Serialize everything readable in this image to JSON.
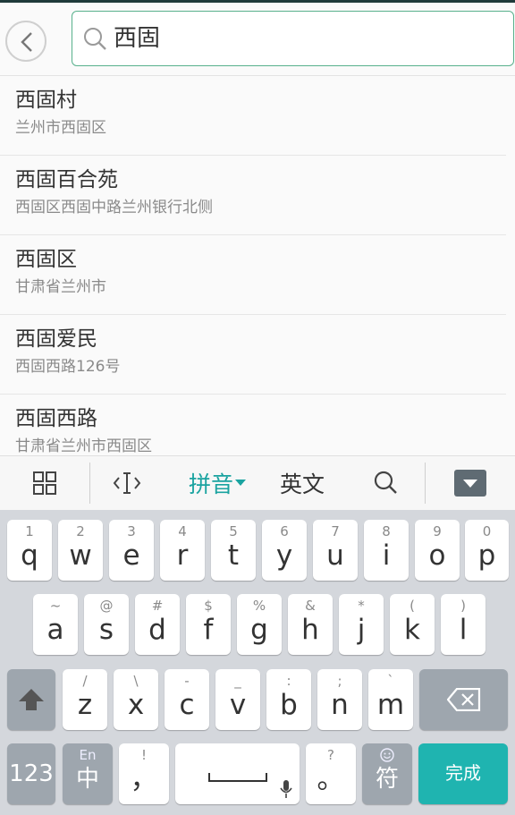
{
  "search": {
    "query": "西固"
  },
  "results": [
    {
      "title": "西固村",
      "subtitle": "兰州市西固区"
    },
    {
      "title": "西固百合苑",
      "subtitle": "西固区西固中路兰州银行北侧"
    },
    {
      "title": "西固区",
      "subtitle": "甘肃省兰州市"
    },
    {
      "title": "西固爱民",
      "subtitle": "西固西路126号"
    },
    {
      "title": "西固西路",
      "subtitle": "甘肃省兰州市西固区"
    }
  ],
  "ime_toolbar": {
    "pinyin_label": "拼音",
    "english_label": "英文"
  },
  "keyboard": {
    "row1": [
      {
        "hint": "1",
        "main": "q"
      },
      {
        "hint": "2",
        "main": "w"
      },
      {
        "hint": "3",
        "main": "e"
      },
      {
        "hint": "4",
        "main": "r"
      },
      {
        "hint": "5",
        "main": "t"
      },
      {
        "hint": "6",
        "main": "y"
      },
      {
        "hint": "7",
        "main": "u"
      },
      {
        "hint": "8",
        "main": "i"
      },
      {
        "hint": "9",
        "main": "o"
      },
      {
        "hint": "0",
        "main": "p"
      }
    ],
    "row2": [
      {
        "hint": "~",
        "main": "a"
      },
      {
        "hint": "@",
        "main": "s"
      },
      {
        "hint": "#",
        "main": "d"
      },
      {
        "hint": "$",
        "main": "f"
      },
      {
        "hint": "%",
        "main": "g"
      },
      {
        "hint": "&",
        "main": "h"
      },
      {
        "hint": "*",
        "main": "j"
      },
      {
        "hint": "(",
        "main": "k"
      },
      {
        "hint": ")",
        "main": "l"
      }
    ],
    "row3": [
      {
        "hint": "/",
        "main": "z"
      },
      {
        "hint": "\\",
        "main": "x"
      },
      {
        "hint": "-",
        "main": "c"
      },
      {
        "hint": "_",
        "main": "v"
      },
      {
        "hint": ":",
        "main": "b"
      },
      {
        "hint": ";",
        "main": "n"
      },
      {
        "hint": "`",
        "main": "m"
      }
    ],
    "num_key": "123",
    "lang_key": {
      "hint": "En",
      "main": "中"
    },
    "comma_key": {
      "hint": "!",
      "main": "，"
    },
    "period_key": {
      "hint": "?",
      "main": "。"
    },
    "symbol_key": "符",
    "done_key": "完成"
  },
  "colors": {
    "accent": "#1aa3a0",
    "search_border": "#58b18c",
    "done_key": "#1fb4b0"
  }
}
